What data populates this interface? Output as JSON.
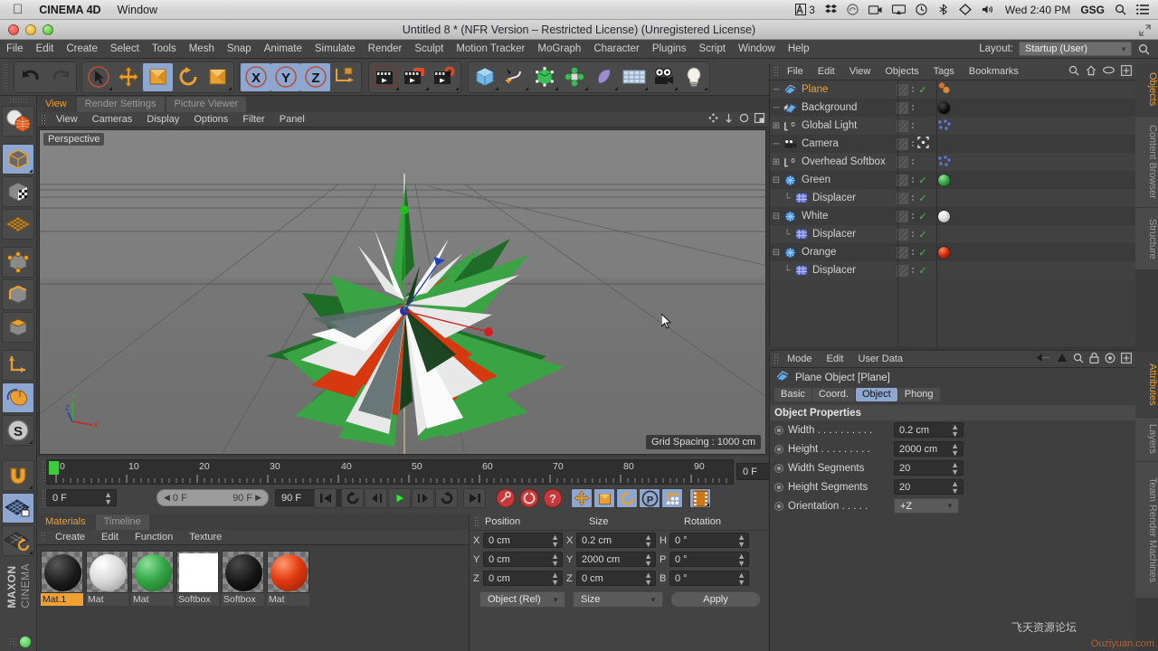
{
  "macbar": {
    "apple_icon": "apple-logo-icon",
    "app_name": "CINEMA 4D",
    "window_menu": "Window",
    "status_items": [
      {
        "name": "adobe-cc-icon",
        "label": "3"
      },
      {
        "name": "dropbox-icon",
        "label": ""
      },
      {
        "name": "creative-cloud-icon",
        "label": ""
      },
      {
        "name": "screen-recorder-icon",
        "label": ""
      },
      {
        "name": "airplay-icon",
        "label": ""
      },
      {
        "name": "time-machine-icon",
        "label": ""
      },
      {
        "name": "bluetooth-icon",
        "label": ""
      },
      {
        "name": "dropbox-badge-icon",
        "label": ""
      },
      {
        "name": "volume-icon",
        "label": ""
      }
    ],
    "clock": "Wed 2:40 PM",
    "user": "GSG",
    "search_icon": "spotlight-search-icon",
    "notification_icon": "notification-center-icon"
  },
  "window": {
    "title": "Untitled 8 * (NFR Version – Restricted License) (Unregistered License)",
    "expand_icon": "expand-window-icon"
  },
  "main_menu": {
    "items": [
      "File",
      "Edit",
      "Create",
      "Select",
      "Tools",
      "Mesh",
      "Snap",
      "Animate",
      "Simulate",
      "Render",
      "Sculpt",
      "Motion Tracker",
      "MoGraph",
      "Character",
      "Plugins",
      "Script",
      "Window",
      "Help"
    ],
    "layout_label": "Layout:",
    "layout_value": "Startup (User)",
    "search_icon": "search-icon"
  },
  "top_toolbar": {
    "groups": [
      {
        "name": "history",
        "buttons": [
          {
            "name": "undo-button",
            "icon": "undo-arrow-icon",
            "active": false
          },
          {
            "name": "redo-button",
            "icon": "redo-arrow-icon",
            "active": false
          }
        ]
      },
      {
        "name": "transform-tools",
        "buttons": [
          {
            "name": "live-selection-button",
            "icon": "cursor-select-icon",
            "active": false
          },
          {
            "name": "move-button",
            "icon": "move-cross-icon",
            "active": false
          },
          {
            "name": "scale-button",
            "icon": "scale-box-icon",
            "active": true
          },
          {
            "name": "rotate-button",
            "icon": "rotate-circle-icon",
            "active": false
          },
          {
            "name": "scale-alt-button",
            "icon": "scale-box-icon",
            "active": false
          }
        ]
      },
      {
        "name": "axis-locks",
        "buttons": [
          {
            "name": "lock-x-button",
            "icon": "x-axis-icon",
            "active": true
          },
          {
            "name": "lock-y-button",
            "icon": "y-axis-icon",
            "active": true
          },
          {
            "name": "lock-z-button",
            "icon": "z-axis-icon",
            "active": true
          },
          {
            "name": "world-object-coords-button",
            "icon": "world-axis-cube-icon",
            "active": false
          }
        ]
      },
      {
        "name": "render-tools",
        "buttons": [
          {
            "name": "render-view-button",
            "icon": "clapperboard-icon",
            "active": false
          },
          {
            "name": "render-to-picture-viewer-button",
            "icon": "clapperboard-picture-icon",
            "active": false
          },
          {
            "name": "render-settings-button",
            "icon": "clapperboard-gear-icon",
            "active": false
          }
        ]
      },
      {
        "name": "create-objects",
        "buttons": [
          {
            "name": "cube-primitive-button",
            "icon": "blue-cube-icon",
            "active": false
          },
          {
            "name": "spline-pen-button",
            "icon": "spline-pen-icon",
            "active": false
          },
          {
            "name": "nurbs-button",
            "icon": "green-cube-nurbs-icon",
            "active": false
          },
          {
            "name": "array-button",
            "icon": "mograph-array-icon",
            "active": false
          },
          {
            "name": "deformer-button",
            "icon": "bend-deformer-icon",
            "active": false
          },
          {
            "name": "environment-button",
            "icon": "floor-grid-icon",
            "active": false
          },
          {
            "name": "camera-button",
            "icon": "camera-icon",
            "active": false
          },
          {
            "name": "light-button",
            "icon": "light-bulb-icon",
            "active": false
          }
        ]
      }
    ]
  },
  "left_toolbar": {
    "buttons": [
      {
        "name": "material-undo-button",
        "icon": "sphere-globe-icon",
        "active": false
      },
      {
        "name": "model-mode-button",
        "icon": "orange-cube-model-icon",
        "active": true
      },
      {
        "name": "texture-mode-button",
        "icon": "checker-cube-icon",
        "active": false
      },
      {
        "name": "workplane-button",
        "icon": "grid-plane-icon",
        "active": false
      },
      {
        "name": "point-mode-button",
        "icon": "point-cube-icon",
        "active": false
      },
      {
        "name": "edge-mode-button",
        "icon": "edge-cube-icon",
        "active": false
      },
      {
        "name": "polygon-mode-button",
        "icon": "polygon-cube-icon",
        "active": false
      },
      {
        "name": "axis-mode-button",
        "icon": "axis-corner-icon",
        "active": false
      },
      {
        "name": "viewport-solo-button",
        "icon": "mouse-icon",
        "active": true
      },
      {
        "name": "sculpt-symmetry-button",
        "icon": "s-circle-icon",
        "active": false
      },
      {
        "name": "snap-button",
        "icon": "magnet-icon",
        "active": false
      },
      {
        "name": "lock-workplane-button",
        "icon": "grid-lock-icon",
        "active": true
      },
      {
        "name": "planar-rotate-button",
        "icon": "grid-rotate-icon",
        "active": false
      }
    ],
    "brand_bold": "MAXON",
    "brand_light": "CINEMA"
  },
  "viewport": {
    "tabs": [
      {
        "label": "View",
        "selected": true
      },
      {
        "label": "Render Settings",
        "selected": false
      },
      {
        "label": "Picture Viewer",
        "selected": false
      }
    ],
    "menu": [
      "View",
      "Cameras",
      "Display",
      "Options",
      "Filter",
      "Panel"
    ],
    "menu_icons": [
      "move-view-icon",
      "scale-view-icon",
      "rotate-view-icon",
      "maximize-view-icon"
    ],
    "label": "Perspective",
    "grid_spacing": "Grid Spacing : 1000 cm",
    "axis_x": "X",
    "axis_y": "Y",
    "axis_z": "Z",
    "cursor_icon": "mouse-cursor-icon"
  },
  "timeline": {
    "ticks": [
      "0",
      "10",
      "20",
      "30",
      "40",
      "50",
      "60",
      "70",
      "80",
      "90"
    ],
    "current_frame": "0 F",
    "preview_start": "0 F",
    "preview_end": "90 F",
    "max_frame": "90 F",
    "playhead_frame": "0 F",
    "buttons": [
      {
        "name": "goto-start-button",
        "icon": "jump-start-icon",
        "active": false
      },
      {
        "name": "loop-button",
        "icon": "loop-icon",
        "active": false
      },
      {
        "name": "step-back-button",
        "icon": "step-back-icon",
        "active": false
      },
      {
        "name": "play-button",
        "icon": "play-icon",
        "active": false
      },
      {
        "name": "step-forward-button",
        "icon": "step-forward-icon",
        "active": false
      },
      {
        "name": "play-reverse-button",
        "icon": "return-arrow-icon",
        "active": false
      },
      {
        "name": "goto-end-button",
        "icon": "jump-end-icon",
        "active": false
      },
      {
        "name": "record-keyframe-button",
        "icon": "red-key-icon",
        "active": false
      },
      {
        "name": "autokey-button",
        "icon": "red-circle-icon",
        "active": false
      },
      {
        "name": "keyframe-question-button",
        "icon": "red-question-icon",
        "active": false
      },
      {
        "name": "key-position-button",
        "icon": "move-cross-icon",
        "active": true
      },
      {
        "name": "key-scale-button",
        "icon": "scale-box-icon",
        "active": true
      },
      {
        "name": "key-rotation-button",
        "icon": "rotate-circle-icon",
        "active": true
      },
      {
        "name": "key-param-button",
        "icon": "p-circle-icon",
        "active": true
      },
      {
        "name": "key-pla-button",
        "icon": "dots-grid-icon",
        "active": true
      },
      {
        "name": "timeline-mode-button",
        "icon": "filmstrip-icon",
        "active": true
      }
    ]
  },
  "materials": {
    "tabs": [
      {
        "label": "Materials",
        "selected": true
      },
      {
        "label": "Timeline",
        "selected": false
      }
    ],
    "menu": [
      "Create",
      "Edit",
      "Function",
      "Texture"
    ],
    "items": [
      {
        "name": "Mat.1",
        "color": "#1b1b1b",
        "shape": "sphere",
        "selected": true
      },
      {
        "name": "Mat",
        "color": "#e6e6e6",
        "shape": "sphere",
        "selected": false
      },
      {
        "name": "Mat",
        "color": "#2f9c3c",
        "shape": "sphere",
        "selected": false
      },
      {
        "name": "Softbox",
        "color": "#ffffff",
        "shape": "flat",
        "selected": false
      },
      {
        "name": "Softbox",
        "color": "#111111",
        "shape": "sphere",
        "selected": false
      },
      {
        "name": "Mat",
        "color": "#e23a10",
        "shape": "sphere",
        "selected": false
      }
    ]
  },
  "coordinates": {
    "headers": [
      "Position",
      "Size",
      "Rotation"
    ],
    "rows": [
      {
        "pos_axis": "X",
        "pos_value": "0 cm",
        "size_axis": "X",
        "size_value": "0.2 cm",
        "rot_axis": "H",
        "rot_value": "0 °"
      },
      {
        "pos_axis": "Y",
        "pos_value": "0 cm",
        "size_axis": "Y",
        "size_value": "2000 cm",
        "rot_axis": "P",
        "rot_value": "0 °"
      },
      {
        "pos_axis": "Z",
        "pos_value": "0 cm",
        "size_axis": "Z",
        "size_value": "0 cm",
        "rot_axis": "B",
        "rot_value": "0 °"
      }
    ],
    "mode_dropdown": "Object (Rel)",
    "size_dropdown": "Size",
    "apply_button": "Apply"
  },
  "object_manager": {
    "menu": [
      "File",
      "Edit",
      "View",
      "Objects",
      "Tags",
      "Bookmarks"
    ],
    "icons": [
      "search-icon",
      "home-icon",
      "eye-icon",
      "expand-panel-icon"
    ],
    "rows": [
      {
        "label": "Plane",
        "icon": "plane-object-icon",
        "indent": 0,
        "expander": "",
        "selected": true,
        "visible_check": true,
        "tag": "material-tag-orange",
        "tag_type": "dots"
      },
      {
        "label": "Background",
        "icon": "background-object-icon",
        "indent": 0,
        "expander": "",
        "selected": false,
        "visible_check": false,
        "tag": "material-tag-black",
        "tag_type": "sphere",
        "tag_color": "#111111"
      },
      {
        "label": "Global Light",
        "icon": "light-object-icon",
        "indent": 0,
        "expander": "+",
        "selected": false,
        "visible_check": false,
        "tag": "mograph-tag",
        "tag_type": "dots-blue"
      },
      {
        "label": "Camera",
        "icon": "camera-object-icon",
        "indent": 0,
        "expander": "",
        "selected": false,
        "visible_check": false,
        "tag": "target-tag",
        "tag_type": "target"
      },
      {
        "label": "Overhead Softbox",
        "icon": "light-object-icon",
        "indent": 0,
        "expander": "+",
        "selected": false,
        "visible_check": false,
        "tag": "mograph-tag",
        "tag_type": "dots-blue"
      },
      {
        "label": "Green",
        "icon": "cloner-object-icon",
        "indent": 0,
        "expander": "-",
        "selected": false,
        "visible_check": true,
        "tag": "material-tag-green",
        "tag_type": "sphere",
        "tag_color": "#2f9c3c"
      },
      {
        "label": "Displacer",
        "icon": "displacer-object-icon",
        "indent": 1,
        "expander": "L",
        "selected": false,
        "visible_check": true,
        "tag": "",
        "tag_type": "none"
      },
      {
        "label": "White",
        "icon": "cloner-object-icon",
        "indent": 0,
        "expander": "-",
        "selected": false,
        "visible_check": true,
        "tag": "material-tag-white",
        "tag_type": "sphere",
        "tag_color": "#e8e8e8"
      },
      {
        "label": "Displacer",
        "icon": "displacer-object-icon",
        "indent": 1,
        "expander": "L",
        "selected": false,
        "visible_check": true,
        "tag": "",
        "tag_type": "none"
      },
      {
        "label": "Orange",
        "icon": "cloner-object-icon",
        "indent": 0,
        "expander": "-",
        "selected": false,
        "visible_check": true,
        "tag": "material-tag-orange",
        "tag_type": "sphere",
        "tag_color": "#d12b10"
      },
      {
        "label": "Displacer",
        "icon": "displacer-object-icon",
        "indent": 1,
        "expander": "L",
        "selected": false,
        "visible_check": true,
        "tag": "",
        "tag_type": "none"
      }
    ]
  },
  "attributes": {
    "menu": [
      "Mode",
      "Edit",
      "User Data"
    ],
    "icons": [
      "back-arrow-icon",
      "up-arrow-icon",
      "search-icon",
      "lock-icon",
      "target-icon",
      "expand-panel-icon"
    ],
    "object_title": "Plane Object [Plane]",
    "object_icon": "plane-object-icon",
    "tabs": [
      {
        "label": "Basic",
        "selected": false
      },
      {
        "label": "Coord.",
        "selected": false
      },
      {
        "label": "Object",
        "selected": true
      },
      {
        "label": "Phong",
        "selected": false
      }
    ],
    "section_title": "Object Properties",
    "properties": [
      {
        "label": "Width . . . . . . . . . .",
        "value": "0.2 cm",
        "type": "field"
      },
      {
        "label": "Height . . . . . . . . .",
        "value": "2000 cm",
        "type": "field"
      },
      {
        "label": "Width Segments",
        "value": "20",
        "type": "field"
      },
      {
        "label": "Height Segments",
        "value": "20",
        "type": "field"
      },
      {
        "label": "Orientation . . . . .",
        "value": "+Z",
        "type": "dropdown"
      }
    ]
  },
  "right_tabs": {
    "top": [
      {
        "label": "Objects",
        "selected": true
      },
      {
        "label": "Content Browser",
        "selected": false
      },
      {
        "label": "Structure",
        "selected": false
      }
    ],
    "bottom": [
      {
        "label": "Attributes",
        "selected": true
      },
      {
        "label": "Layers",
        "selected": false
      },
      {
        "label": "Team Render Machines",
        "selected": false
      }
    ]
  },
  "watermark": {
    "text_cn": "飞天资源论坛",
    "text_site": "Ouziyuan.com"
  },
  "colors": {
    "accent_orange": "#f0a030",
    "active_blue": "#8ea7d0",
    "panel_bg": "#3f3f3f",
    "toolbar_bg": "#434343",
    "viewport_bg": "#7b7b7b",
    "check_green": "#46c246"
  }
}
